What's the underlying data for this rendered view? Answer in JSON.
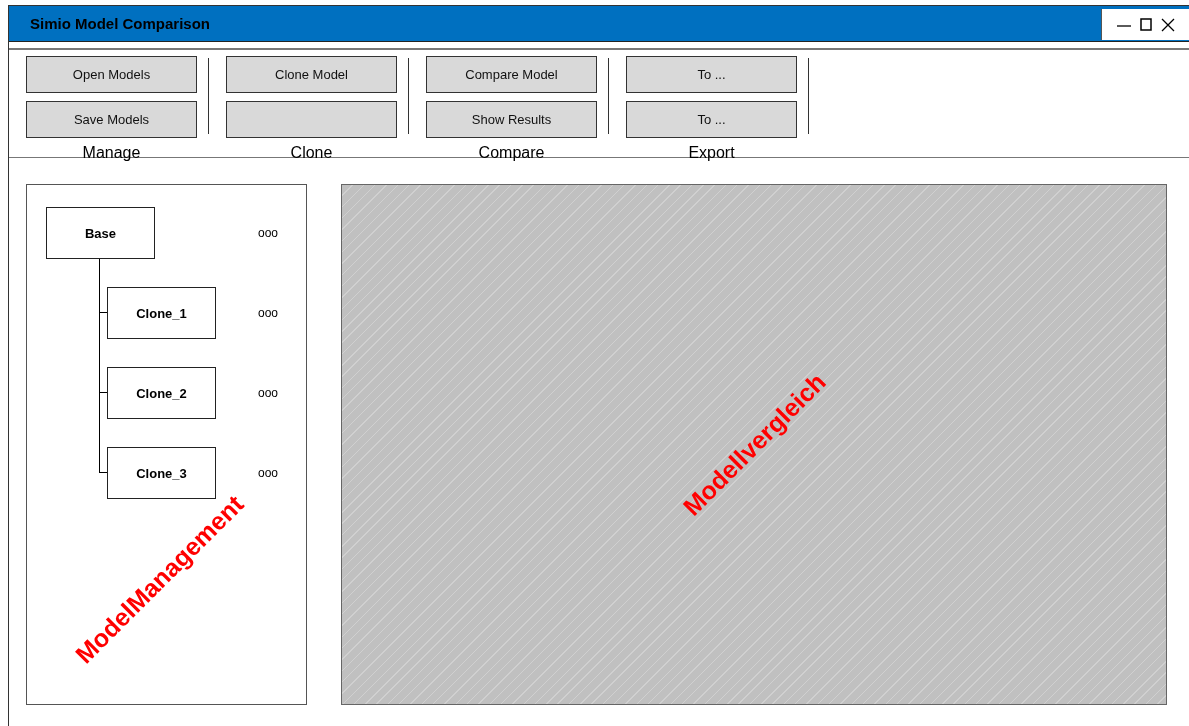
{
  "window": {
    "title": "Simio Model Comparison"
  },
  "ribbon": {
    "groups": [
      {
        "label": "Manage",
        "buttons": [
          {
            "kind": "text",
            "label": "Open Models"
          },
          {
            "kind": "text",
            "label": "Save Models"
          }
        ]
      },
      {
        "label": "Clone",
        "buttons": [
          {
            "kind": "text",
            "label": "Clone Model"
          },
          {
            "kind": "blank"
          }
        ]
      },
      {
        "label": "Compare",
        "buttons": [
          {
            "kind": "text",
            "label": "Compare Model"
          },
          {
            "kind": "text",
            "label": "Show Results"
          }
        ]
      },
      {
        "label": "Export",
        "buttons": [
          {
            "kind": "text",
            "label": "To ..."
          },
          {
            "kind": "text",
            "label": "To ..."
          }
        ]
      }
    ]
  },
  "model_tree": {
    "annotation": "ModelManagement",
    "nodes": [
      {
        "label": "Base",
        "more": "ooo",
        "children": [
          {
            "label": "Clone_1",
            "more": "ooo"
          },
          {
            "label": "Clone_2",
            "more": "ooo"
          },
          {
            "label": "Clone_3",
            "more": "ooo"
          }
        ]
      }
    ]
  },
  "comparison_panel": {
    "annotation": "Modellvergleich"
  }
}
